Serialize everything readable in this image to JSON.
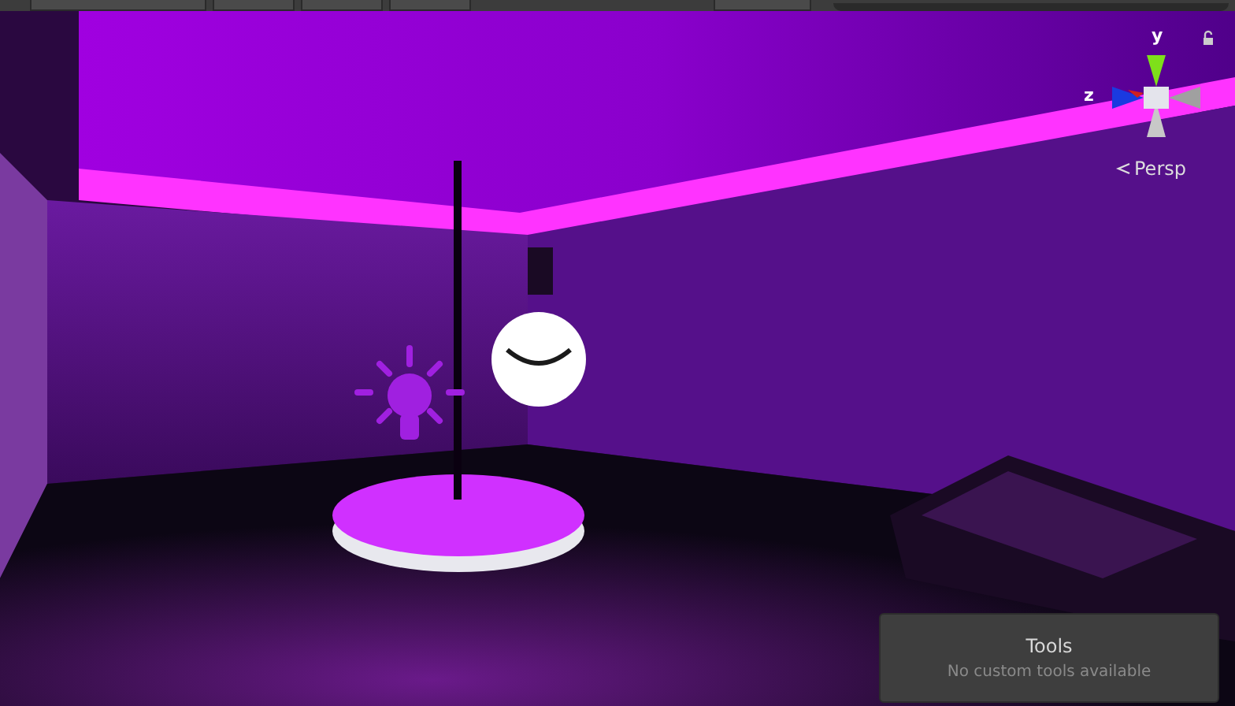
{
  "scene_view": {
    "gizmo": {
      "axes": [
        {
          "label": "y",
          "kind": "up"
        },
        {
          "label": "z",
          "kind": "side"
        }
      ],
      "projection": "Persp"
    },
    "tools_overlay": {
      "title": "Tools",
      "message": "No custom tools available"
    }
  }
}
